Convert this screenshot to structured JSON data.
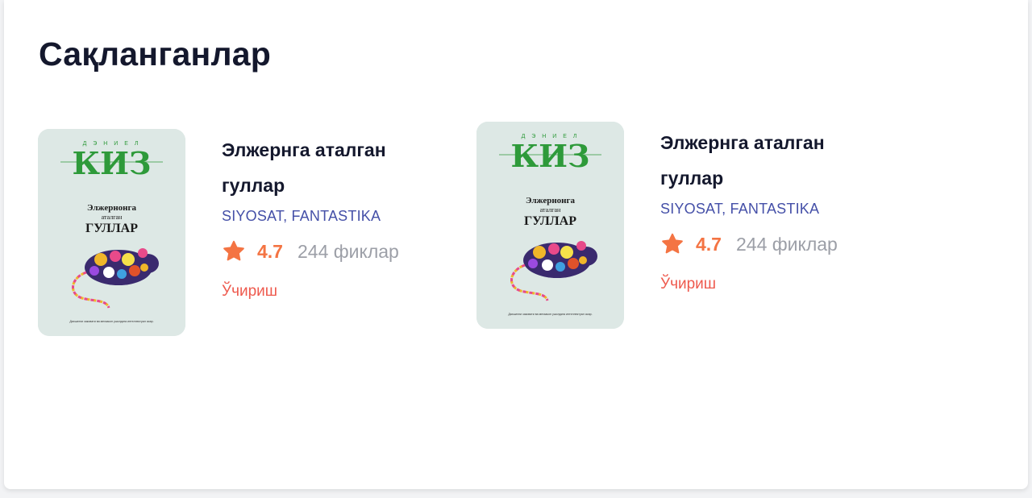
{
  "page": {
    "title": "Сақланганлар"
  },
  "colors": {
    "title": "#14182d",
    "genre": "#4550a8",
    "rating": "#f47443",
    "reviews": "#9c9fa7",
    "remove": "#ee5a4e",
    "cover_bg": "#dde8e5",
    "cover_accent": "#2e9a3a"
  },
  "books": [
    {
      "title": "Элжернга аталган гуллар",
      "genres": "SIYOSAT, FANTASTIKA",
      "rating": "4.7",
      "reviews": "244 фиклар",
      "remove_label": "Ўчириш",
      "cover": {
        "author_small": "Д Э Н И Е Л",
        "author_big": "КИЗ",
        "title_line1": "Элжернонга",
        "title_line2": "аталган",
        "title_line3": "ГУЛЛАР",
        "footer": "Дахшатли заковати ва мехзакоп ушолдига интеллектуал асар."
      }
    },
    {
      "title": "Элжернга аталган гуллар",
      "genres": "SIYOSAT, FANTASTIKA",
      "rating": "4.7",
      "reviews": "244 фиклар",
      "remove_label": "Ўчириш",
      "cover": {
        "author_small": "Д Э Н И Е Л",
        "author_big": "КИЗ",
        "title_line1": "Элжернонга",
        "title_line2": "аталган",
        "title_line3": "ГУЛЛАР",
        "footer": "Дахшатли заковати ва мехзакоп ушолдига интеллектуал асар."
      }
    }
  ]
}
